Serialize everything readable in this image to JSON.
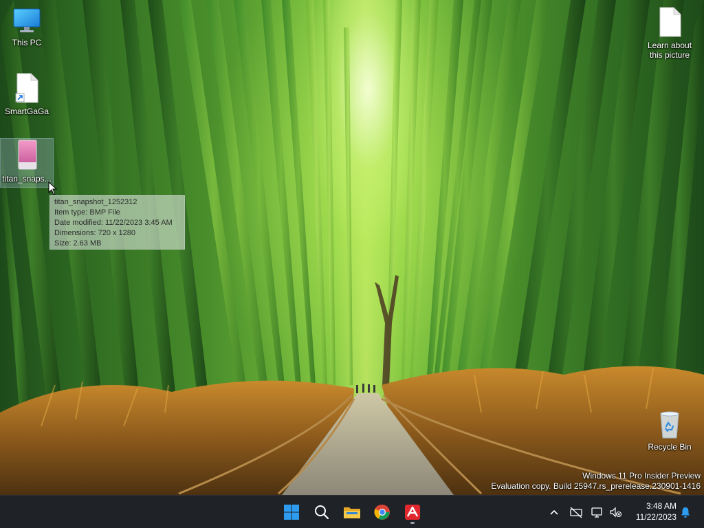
{
  "desktop": {
    "icons": [
      {
        "label": "This PC"
      },
      {
        "label": "SmartGaGa"
      },
      {
        "label": "titan_snaps..."
      },
      {
        "label": "Learn about this picture"
      },
      {
        "label": "Recycle Bin"
      }
    ]
  },
  "tooltip": {
    "name": "titan_snapshot_1252312",
    "item_type": "Item type: BMP File",
    "date_modified": "Date modified: 11/22/2023 3:45 AM",
    "dimensions": "Dimensions: 720 x 1280",
    "size": "Size: 2.63 MB"
  },
  "watermark": {
    "line1": "Windows 11 Pro Insider Preview",
    "line2": "Evaluation copy. Build 25947.rs_prerelease.230901-1416"
  },
  "taskbar": {
    "apps": [
      {
        "icon": "windows-start-icon"
      },
      {
        "icon": "search-icon"
      },
      {
        "icon": "file-explorer-icon"
      },
      {
        "icon": "chrome-icon"
      },
      {
        "icon": "red-app-icon"
      }
    ],
    "tray": {
      "time": "3:48 AM",
      "date": "11/22/2023"
    }
  },
  "colors": {
    "taskbar_bg": "#1f2227",
    "accent_blue": "#2d9cf0",
    "app_red": "#e0282e"
  }
}
